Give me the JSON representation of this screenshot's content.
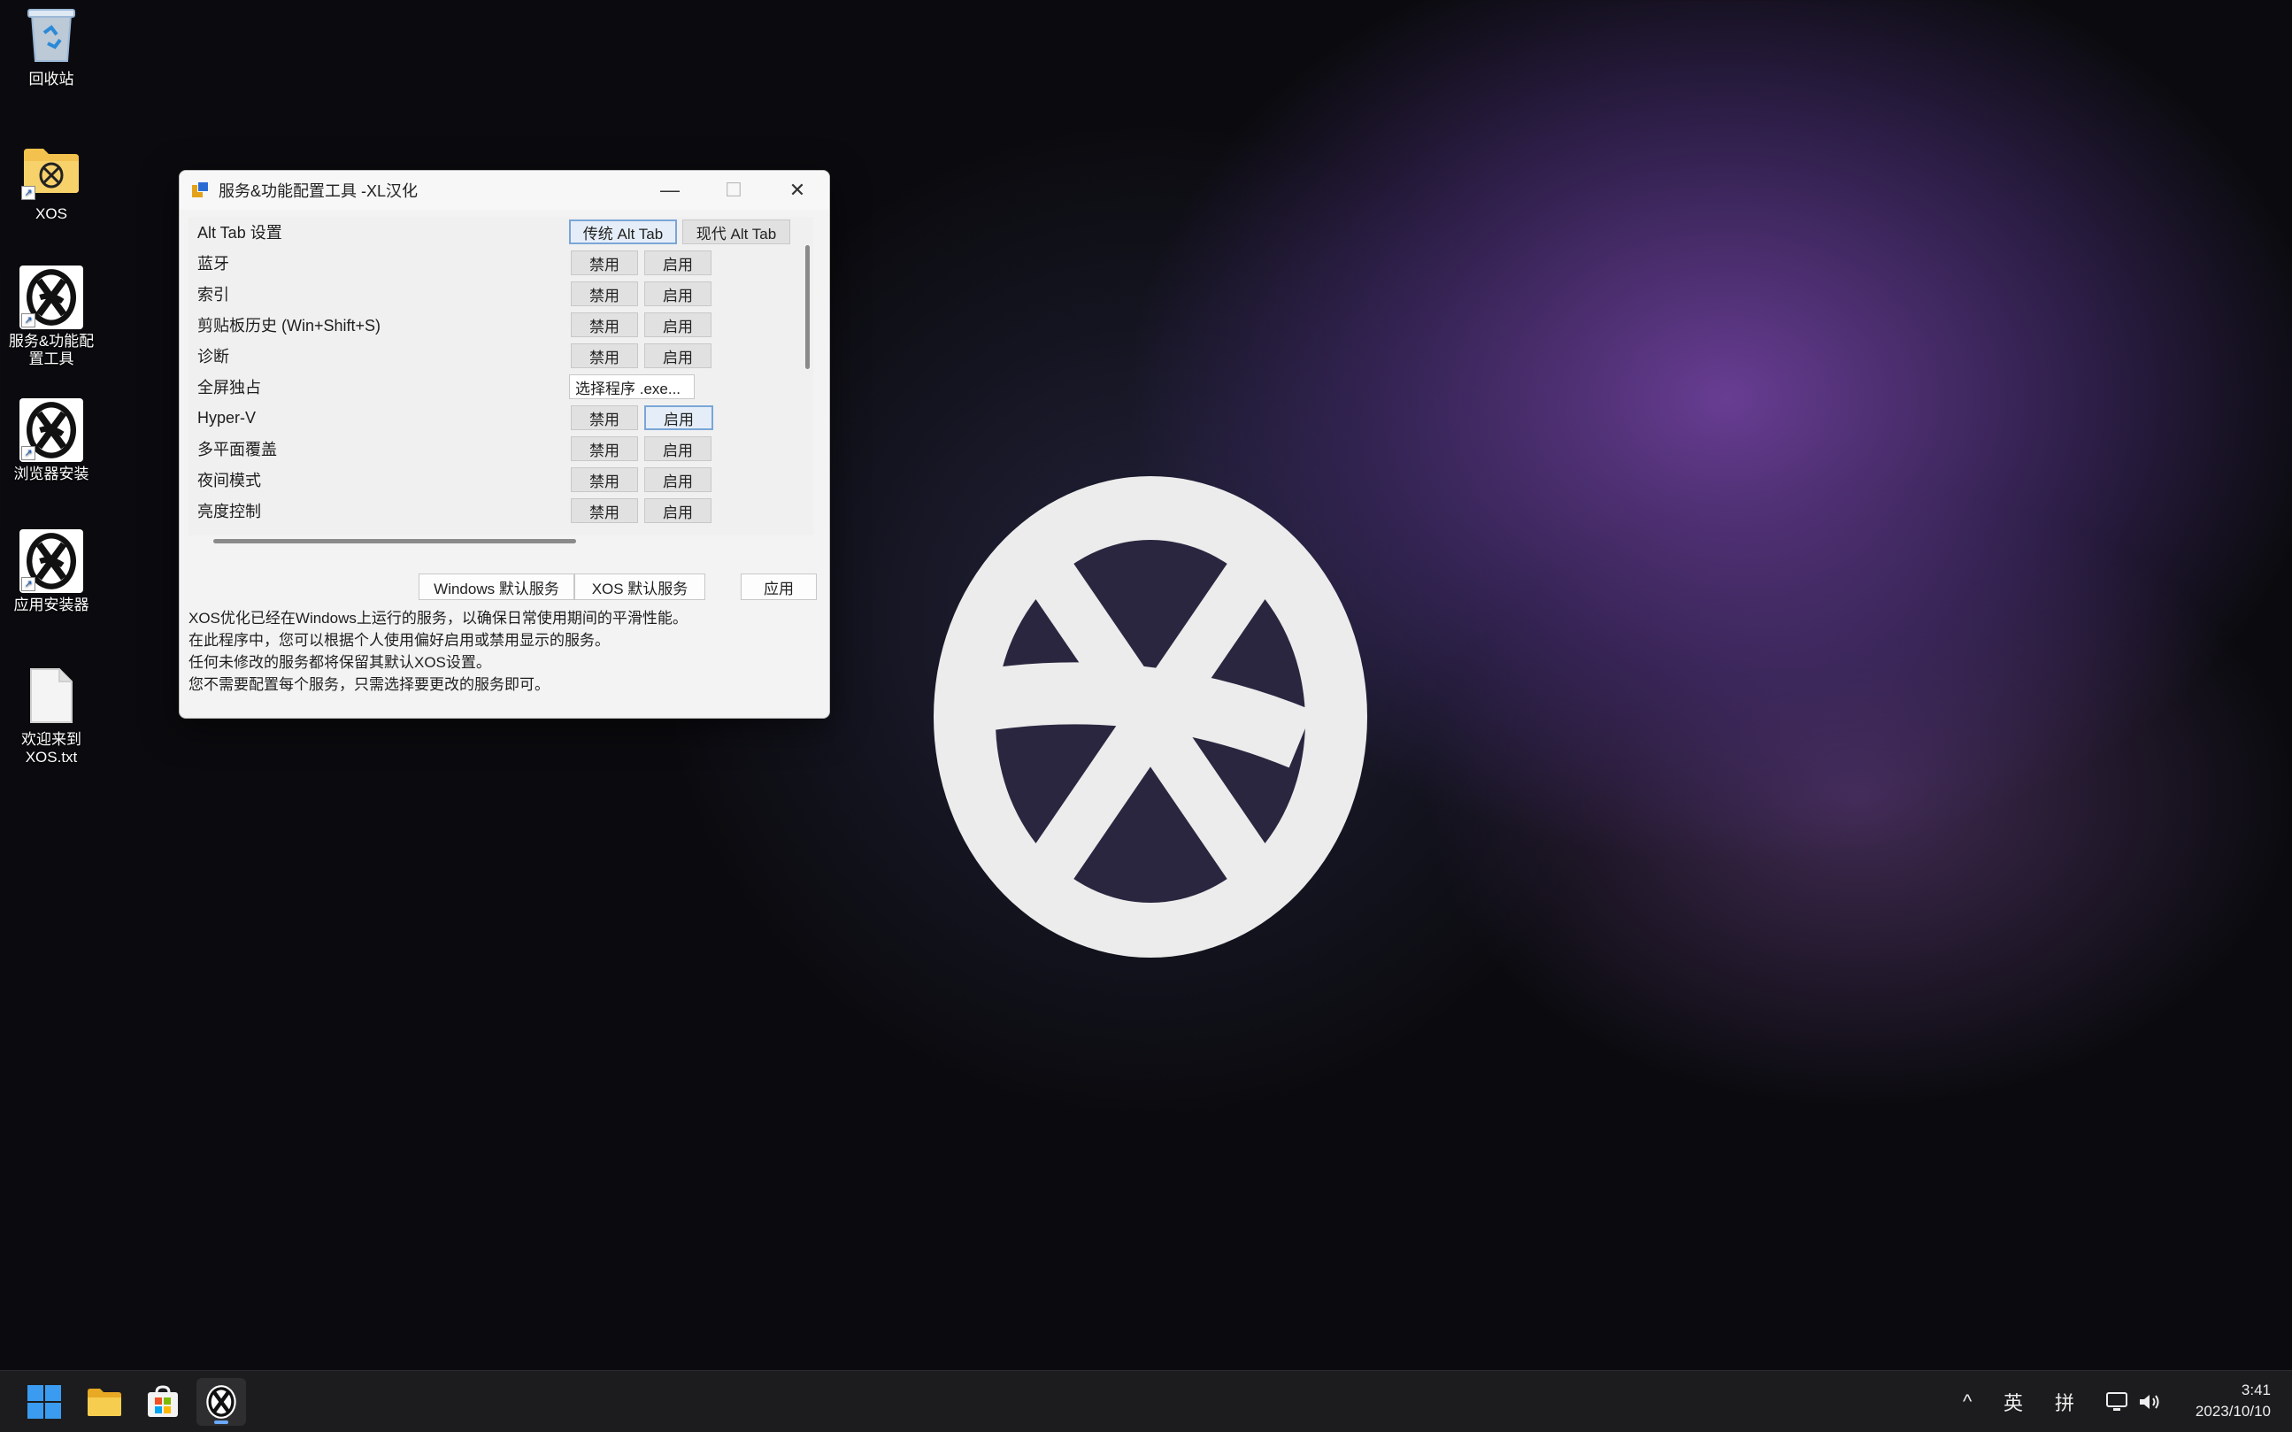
{
  "desktop": {
    "icons": [
      {
        "label": "回收站",
        "icon": "recycle-bin-icon"
      },
      {
        "label": "XOS",
        "icon": "folder-icon"
      },
      {
        "label": "服务&功能配\n置工具",
        "icon": "xos-logo-icon"
      },
      {
        "label": "浏览器安装",
        "icon": "xos-logo-icon"
      },
      {
        "label": "应用安装器",
        "icon": "xos-logo-icon"
      },
      {
        "label": "欢迎来到\nXOS.txt",
        "icon": "text-file-icon"
      }
    ]
  },
  "window": {
    "title": "服务&功能配置工具 -XL汉化",
    "controls": {
      "minimize": "—",
      "maximize": "☐",
      "close": "✕"
    },
    "rows": [
      {
        "label": "Alt Tab 设置",
        "buttons": [
          "传统 Alt Tab",
          "现代 Alt Tab"
        ]
      },
      {
        "label": "蓝牙",
        "buttons": [
          "禁用",
          "启用"
        ]
      },
      {
        "label": "索引",
        "buttons": [
          "禁用",
          "启用"
        ]
      },
      {
        "label": "剪贴板历史 (Win+Shift+S)",
        "buttons": [
          "禁用",
          "启用"
        ]
      },
      {
        "label": "诊断",
        "buttons": [
          "禁用",
          "启用"
        ]
      },
      {
        "label": "全屏独占",
        "buttons": [
          "选择程序 .exe..."
        ]
      },
      {
        "label": "Hyper-V",
        "buttons": [
          "禁用",
          "启用"
        ]
      },
      {
        "label": "多平面覆盖",
        "buttons": [
          "禁用",
          "启用"
        ]
      },
      {
        "label": "夜间模式",
        "buttons": [
          "禁用",
          "启用"
        ]
      },
      {
        "label": "亮度控制",
        "buttons": [
          "禁用",
          "启用"
        ]
      }
    ],
    "bottom_buttons": {
      "windows_default": "Windows 默认服务",
      "xos_default": "XOS 默认服务",
      "apply": "应用"
    },
    "description": [
      "XOS优化已经在Windows上运行的服务，以确保日常使用期间的平滑性能。",
      "在此程序中，您可以根据个人使用偏好启用或禁用显示的服务。",
      "任何未修改的服务都将保留其默认XOS设置。",
      "您不需要配置每个服务，只需选择要更改的服务即可。"
    ]
  },
  "taskbar": {
    "items": [
      {
        "name": "start-button",
        "icon": "windows-icon"
      },
      {
        "name": "file-explorer",
        "icon": "folder-icon"
      },
      {
        "name": "microsoft-store",
        "icon": "store-icon"
      },
      {
        "name": "config-tool",
        "icon": "xos-logo-icon"
      }
    ],
    "tray": {
      "chevron": "^",
      "ime_mode": "英",
      "ime_name": "拼",
      "network": "network-icon",
      "volume": "volume-icon"
    },
    "time": "3:41",
    "date": "2023/10/10"
  },
  "colors": {
    "accent": "#2b6cd4",
    "taskbar": "#1c1c1e",
    "window_bg": "#f3f3f3"
  }
}
